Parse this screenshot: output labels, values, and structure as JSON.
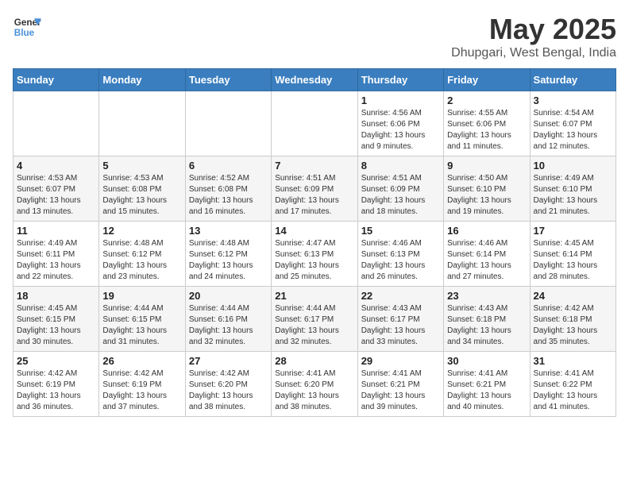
{
  "header": {
    "logo_line1": "General",
    "logo_line2": "Blue",
    "title": "May 2025",
    "subtitle": "Dhupgari, West Bengal, India"
  },
  "days_of_week": [
    "Sunday",
    "Monday",
    "Tuesday",
    "Wednesday",
    "Thursday",
    "Friday",
    "Saturday"
  ],
  "weeks": [
    [
      {
        "day": "",
        "info": ""
      },
      {
        "day": "",
        "info": ""
      },
      {
        "day": "",
        "info": ""
      },
      {
        "day": "",
        "info": ""
      },
      {
        "day": "1",
        "info": "Sunrise: 4:56 AM\nSunset: 6:06 PM\nDaylight: 13 hours and 9 minutes."
      },
      {
        "day": "2",
        "info": "Sunrise: 4:55 AM\nSunset: 6:06 PM\nDaylight: 13 hours and 11 minutes."
      },
      {
        "day": "3",
        "info": "Sunrise: 4:54 AM\nSunset: 6:07 PM\nDaylight: 13 hours and 12 minutes."
      }
    ],
    [
      {
        "day": "4",
        "info": "Sunrise: 4:53 AM\nSunset: 6:07 PM\nDaylight: 13 hours and 13 minutes."
      },
      {
        "day": "5",
        "info": "Sunrise: 4:53 AM\nSunset: 6:08 PM\nDaylight: 13 hours and 15 minutes."
      },
      {
        "day": "6",
        "info": "Sunrise: 4:52 AM\nSunset: 6:08 PM\nDaylight: 13 hours and 16 minutes."
      },
      {
        "day": "7",
        "info": "Sunrise: 4:51 AM\nSunset: 6:09 PM\nDaylight: 13 hours and 17 minutes."
      },
      {
        "day": "8",
        "info": "Sunrise: 4:51 AM\nSunset: 6:09 PM\nDaylight: 13 hours and 18 minutes."
      },
      {
        "day": "9",
        "info": "Sunrise: 4:50 AM\nSunset: 6:10 PM\nDaylight: 13 hours and 19 minutes."
      },
      {
        "day": "10",
        "info": "Sunrise: 4:49 AM\nSunset: 6:10 PM\nDaylight: 13 hours and 21 minutes."
      }
    ],
    [
      {
        "day": "11",
        "info": "Sunrise: 4:49 AM\nSunset: 6:11 PM\nDaylight: 13 hours and 22 minutes."
      },
      {
        "day": "12",
        "info": "Sunrise: 4:48 AM\nSunset: 6:12 PM\nDaylight: 13 hours and 23 minutes."
      },
      {
        "day": "13",
        "info": "Sunrise: 4:48 AM\nSunset: 6:12 PM\nDaylight: 13 hours and 24 minutes."
      },
      {
        "day": "14",
        "info": "Sunrise: 4:47 AM\nSunset: 6:13 PM\nDaylight: 13 hours and 25 minutes."
      },
      {
        "day": "15",
        "info": "Sunrise: 4:46 AM\nSunset: 6:13 PM\nDaylight: 13 hours and 26 minutes."
      },
      {
        "day": "16",
        "info": "Sunrise: 4:46 AM\nSunset: 6:14 PM\nDaylight: 13 hours and 27 minutes."
      },
      {
        "day": "17",
        "info": "Sunrise: 4:45 AM\nSunset: 6:14 PM\nDaylight: 13 hours and 28 minutes."
      }
    ],
    [
      {
        "day": "18",
        "info": "Sunrise: 4:45 AM\nSunset: 6:15 PM\nDaylight: 13 hours and 30 minutes."
      },
      {
        "day": "19",
        "info": "Sunrise: 4:44 AM\nSunset: 6:15 PM\nDaylight: 13 hours and 31 minutes."
      },
      {
        "day": "20",
        "info": "Sunrise: 4:44 AM\nSunset: 6:16 PM\nDaylight: 13 hours and 32 minutes."
      },
      {
        "day": "21",
        "info": "Sunrise: 4:44 AM\nSunset: 6:17 PM\nDaylight: 13 hours and 32 minutes."
      },
      {
        "day": "22",
        "info": "Sunrise: 4:43 AM\nSunset: 6:17 PM\nDaylight: 13 hours and 33 minutes."
      },
      {
        "day": "23",
        "info": "Sunrise: 4:43 AM\nSunset: 6:18 PM\nDaylight: 13 hours and 34 minutes."
      },
      {
        "day": "24",
        "info": "Sunrise: 4:42 AM\nSunset: 6:18 PM\nDaylight: 13 hours and 35 minutes."
      }
    ],
    [
      {
        "day": "25",
        "info": "Sunrise: 4:42 AM\nSunset: 6:19 PM\nDaylight: 13 hours and 36 minutes."
      },
      {
        "day": "26",
        "info": "Sunrise: 4:42 AM\nSunset: 6:19 PM\nDaylight: 13 hours and 37 minutes."
      },
      {
        "day": "27",
        "info": "Sunrise: 4:42 AM\nSunset: 6:20 PM\nDaylight: 13 hours and 38 minutes."
      },
      {
        "day": "28",
        "info": "Sunrise: 4:41 AM\nSunset: 6:20 PM\nDaylight: 13 hours and 38 minutes."
      },
      {
        "day": "29",
        "info": "Sunrise: 4:41 AM\nSunset: 6:21 PM\nDaylight: 13 hours and 39 minutes."
      },
      {
        "day": "30",
        "info": "Sunrise: 4:41 AM\nSunset: 6:21 PM\nDaylight: 13 hours and 40 minutes."
      },
      {
        "day": "31",
        "info": "Sunrise: 4:41 AM\nSunset: 6:22 PM\nDaylight: 13 hours and 41 minutes."
      }
    ]
  ]
}
